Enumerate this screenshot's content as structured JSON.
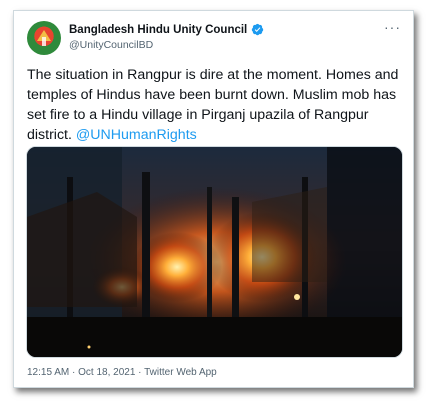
{
  "tweet": {
    "display_name": "Bangladesh Hindu Unity Council",
    "handle": "@UnityCouncilBD",
    "verified_icon": "verified-badge-icon",
    "more_icon": "more-options-icon",
    "more_label": "···",
    "text_main": "The situation in Rangpur is dire at the moment. Homes and temples of Hindus have been burnt down. Muslim mob has set fire to a Hindu village in Pirganj upazila of Rangpur district.",
    "mention": "@UNHumanRights",
    "meta": "12:15 AM · Oct 18, 2021 · Twitter Web App"
  },
  "colors": {
    "link": "#1d9bf0",
    "verified": "#1d9bf0",
    "secondary_text": "#536471"
  }
}
